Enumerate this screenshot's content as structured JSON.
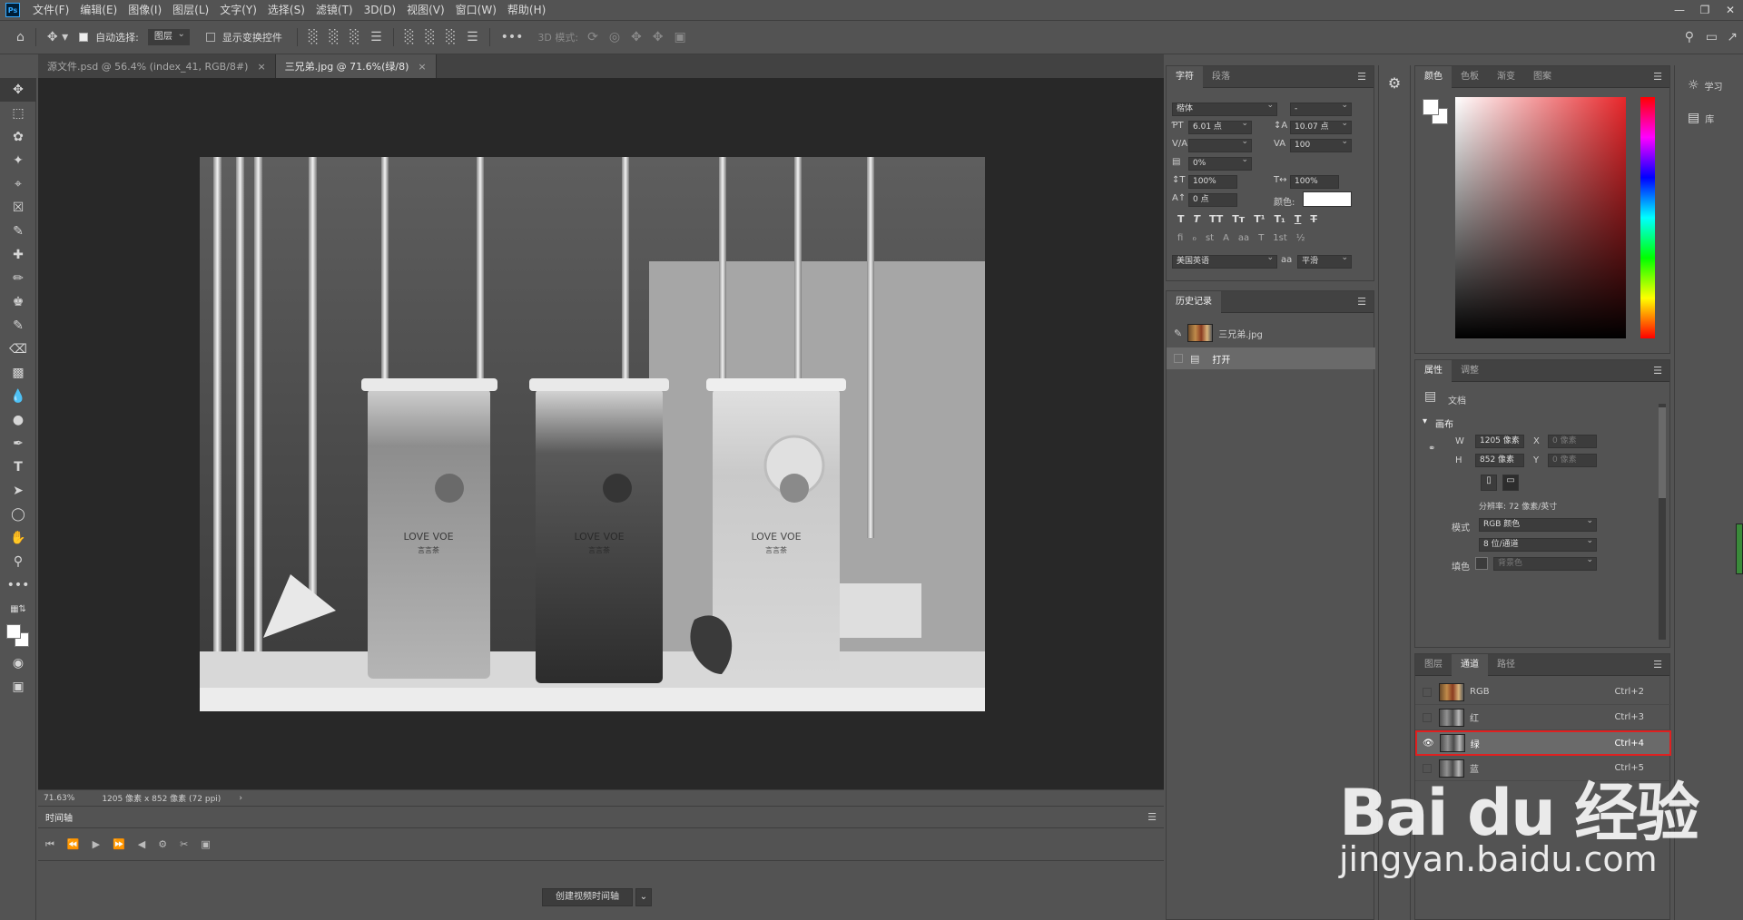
{
  "app": {
    "logo": "Ps"
  },
  "menu": [
    "文件(F)",
    "编辑(E)",
    "图像(I)",
    "图层(L)",
    "文字(Y)",
    "选择(S)",
    "滤镜(T)",
    "3D(D)",
    "视图(V)",
    "窗口(W)",
    "帮助(H)"
  ],
  "options": {
    "auto_select_label": "自动选择:",
    "auto_select_value": "图层",
    "show_transform_label": "显示变换控件",
    "mode_3d_label": "3D 模式:"
  },
  "doc_tabs": [
    {
      "label": "源文件.psd @ 56.4% (index_41, RGB/8#)",
      "close": "×"
    },
    {
      "label": "三兄弟.jpg @ 71.6%(绿/8)",
      "close": "×"
    }
  ],
  "status": {
    "zoom": "71.63%",
    "dims": "1205 像素 x 852 像素 (72 ppi)"
  },
  "timeline": {
    "tab": "时间轴",
    "create_button": "创建视频时间轴"
  },
  "character": {
    "tabs": [
      "字符",
      "段落"
    ],
    "font_family": "楷体",
    "font_style": "-",
    "size": "6.01 点",
    "leading": "10.07 点",
    "kerning": "",
    "tracking": "100",
    "scale_pct": "0%",
    "vscale": "100%",
    "hscale": "100%",
    "baseline": "0 点",
    "color_label": "颜色:",
    "language": "美国英语",
    "aa_label": "aa",
    "antialias": "平滑",
    "typo_row1": [
      "T",
      "T",
      "TT",
      "Tт",
      "T¹",
      "T₁",
      "T",
      "T"
    ],
    "typo_row2": [
      "fi",
      "ℴ",
      "st",
      "A",
      "aa",
      "T",
      "1st",
      "½"
    ]
  },
  "history": {
    "tab": "历史记录",
    "snapshot": "三兄弟.jpg",
    "items": [
      "打开"
    ]
  },
  "color": {
    "tabs": [
      "颜色",
      "色板",
      "渐变",
      "图案"
    ],
    "accent": "#e8262a"
  },
  "properties": {
    "tabs": [
      "属性",
      "调整"
    ],
    "doc_label": "文档",
    "canvas_section": "画布",
    "w_label": "W",
    "w_value": "1205 像素",
    "h_label": "H",
    "h_value": "852 像素",
    "x_label": "X",
    "x_value": "0 像素",
    "y_label": "Y",
    "y_value": "0 像素",
    "resolution": "分辨率: 72 像素/英寸",
    "mode_label": "模式",
    "mode_value": "RGB 颜色",
    "depth_value": "8 位/通道",
    "fill_label": "填色",
    "fill_value": "背景色"
  },
  "channels": {
    "tabs": [
      "图层",
      "通道",
      "路径"
    ],
    "rows": [
      {
        "name": "RGB",
        "shortcut": "Ctrl+2"
      },
      {
        "name": "红",
        "shortcut": "Ctrl+3"
      },
      {
        "name": "绿",
        "shortcut": "Ctrl+4"
      },
      {
        "name": "蓝",
        "shortcut": "Ctrl+5"
      }
    ],
    "highlight_color": "#e02020"
  },
  "right_strip": {
    "learn": "学习",
    "library": "库"
  },
  "artwork": {
    "brand_line1": "LOVE VOE",
    "brand_line2": "言言茶"
  },
  "watermark": {
    "brand": "Bai du 经验",
    "url": "jingyan.baidu.com"
  }
}
